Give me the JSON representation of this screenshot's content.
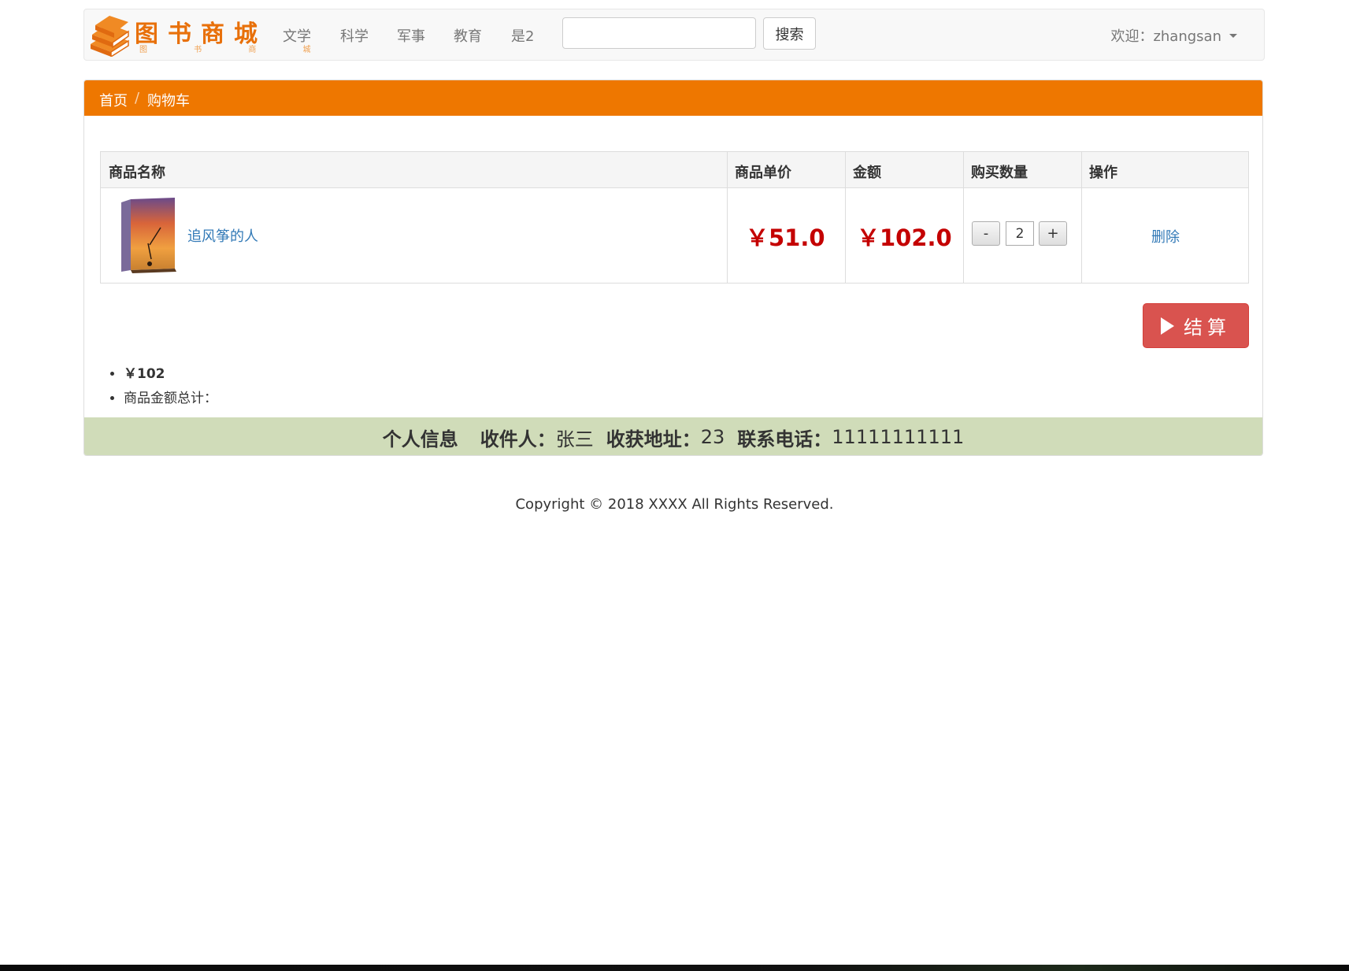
{
  "navbar": {
    "logo_text": "图书商城",
    "logo_subtext": "图 书 商 城",
    "links": [
      "文学",
      "科学",
      "军事",
      "教育",
      "是2"
    ],
    "search_value": "",
    "search_button": "搜索",
    "welcome": "欢迎：zhangsan"
  },
  "breadcrumb": {
    "home": "首页",
    "separator": "/",
    "current": "购物车"
  },
  "table": {
    "headers": [
      "商品名称",
      "商品单价",
      "金额",
      "购买数量",
      "操作"
    ],
    "row": {
      "name": "追风筝的人",
      "unit_price": "￥51.0",
      "amount": "￥102.0",
      "minus": "-",
      "quantity": "2",
      "plus": "+",
      "action": "删除"
    }
  },
  "checkout": {
    "label": "结算"
  },
  "summary": {
    "total": "￥102",
    "total_label": "商品金额总计："
  },
  "info": {
    "title": "个人信息",
    "receiver_label": "收件人：",
    "receiver": "张三",
    "address_label": "收获地址：",
    "address": "23",
    "phone_label": "联系电话：",
    "phone": "11111111111"
  },
  "footer": {
    "copyright": "Copyright © 2018 XXXX All Rights Reserved."
  },
  "colors": {
    "accent": "#ee7700",
    "price_red": "#c40000",
    "checkout_red": "#d9534f",
    "info_bar": "#d0dcb9",
    "link_blue": "#337ab7"
  }
}
